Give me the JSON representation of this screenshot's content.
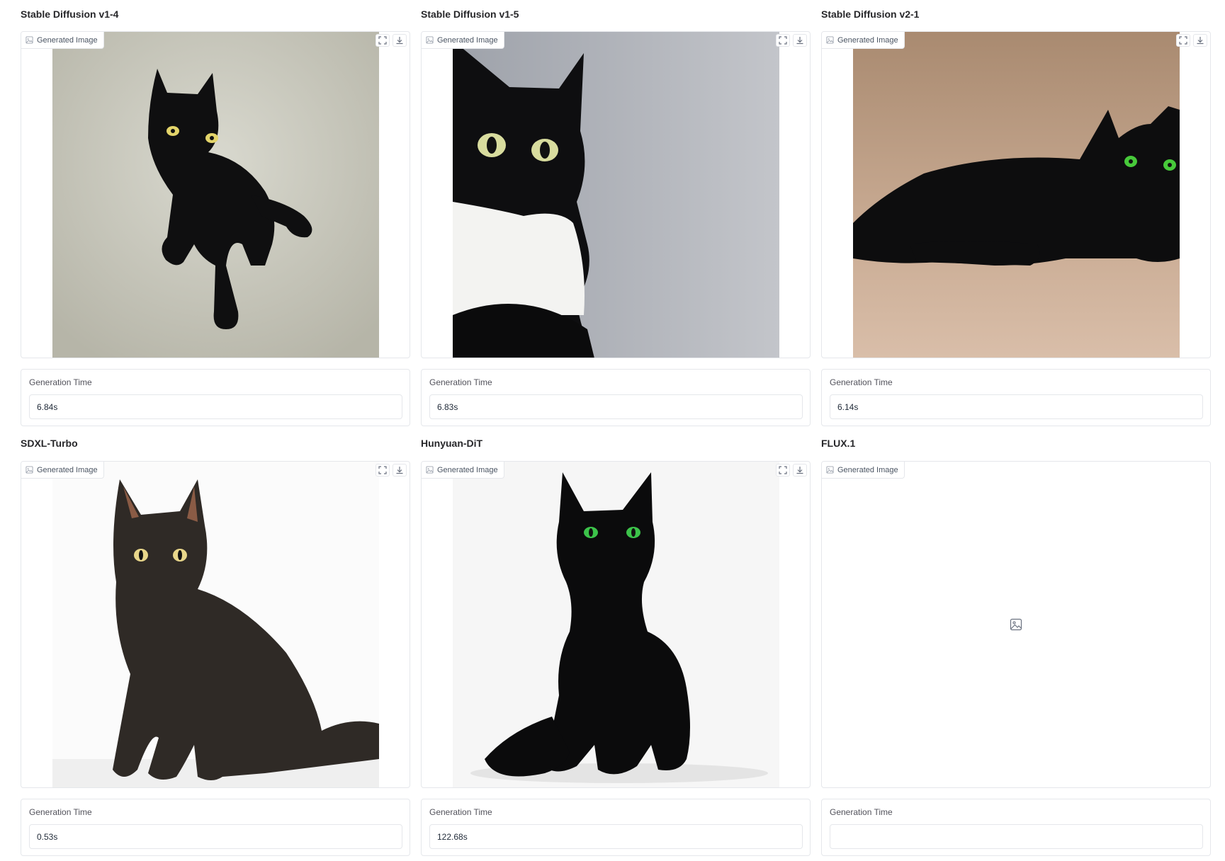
{
  "panels": [
    {
      "title": "Stable Diffusion v1-4",
      "image_label": "Generated Image",
      "time_label": "Generation Time",
      "time_value": "6.84s",
      "has_image": true
    },
    {
      "title": "Stable Diffusion v1-5",
      "image_label": "Generated Image",
      "time_label": "Generation Time",
      "time_value": "6.83s",
      "has_image": true
    },
    {
      "title": "Stable Diffusion v2-1",
      "image_label": "Generated Image",
      "time_label": "Generation Time",
      "time_value": "6.14s",
      "has_image": true
    },
    {
      "title": "SDXL-Turbo",
      "image_label": "Generated Image",
      "time_label": "Generation Time",
      "time_value": "0.53s",
      "has_image": true
    },
    {
      "title": "Hunyuan-DiT",
      "image_label": "Generated Image",
      "time_label": "Generation Time",
      "time_value": "122.68s",
      "has_image": true
    },
    {
      "title": "FLUX.1",
      "image_label": "Generated Image",
      "time_label": "Generation Time",
      "time_value": "",
      "has_image": false
    }
  ],
  "icons": {
    "fullscreen": "fullscreen-icon",
    "download": "download-icon",
    "image": "image-icon"
  },
  "colors": {
    "border": "#e5e7eb",
    "text": "#27272a",
    "muted": "#52525b"
  }
}
